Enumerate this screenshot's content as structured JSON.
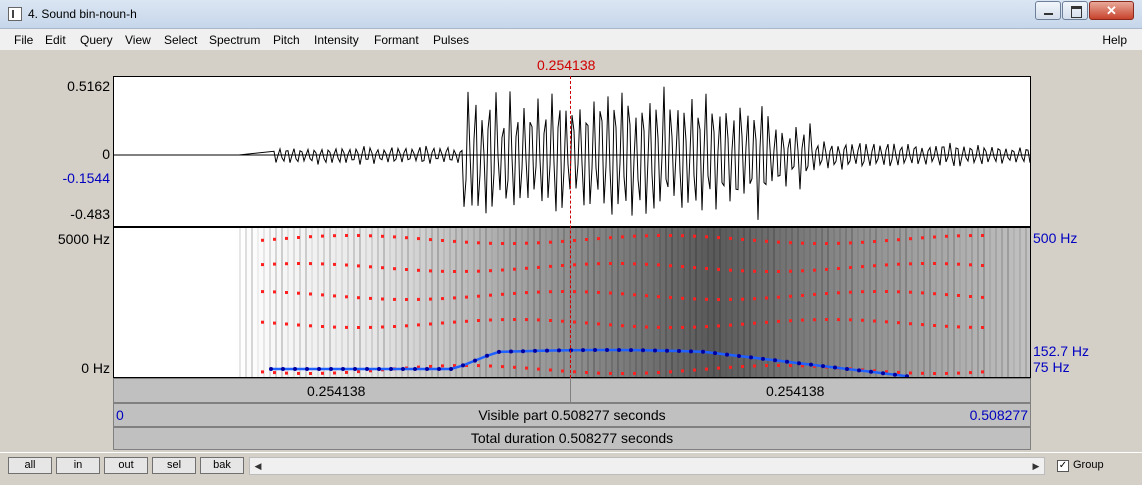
{
  "window": {
    "title": "4. Sound bin-noun-h"
  },
  "menu": {
    "items": [
      "File",
      "Edit",
      "Query",
      "View",
      "Select",
      "Spectrum",
      "Pitch",
      "Intensity",
      "Formant",
      "Pulses"
    ],
    "help": "Help"
  },
  "waveform": {
    "cursor_time": "0.254138",
    "y_max": "0.5162",
    "y_zero": "0",
    "y_cursor": "-0.1544",
    "y_min": "-0.483"
  },
  "spectrogram": {
    "freq_max": "5000 Hz",
    "freq_min": "0 Hz",
    "right_top": "500 Hz",
    "pitch_value": "152.7 Hz",
    "pitch_floor": "75 Hz"
  },
  "timebars": {
    "sel_left": "0.254138",
    "sel_right": "0.254138",
    "visible_start": "0",
    "visible_text": "Visible part 0.508277 seconds",
    "visible_end": "0.508277",
    "total_text": "Total duration 0.508277 seconds"
  },
  "bottom": {
    "buttons": [
      "all",
      "in",
      "out",
      "sel",
      "bak"
    ],
    "group_label": "Group",
    "group_checked": true
  }
}
